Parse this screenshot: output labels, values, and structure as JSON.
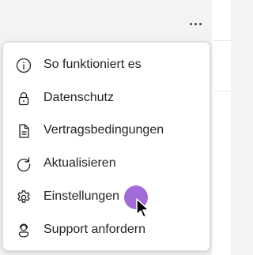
{
  "toolbar": {
    "more_icon": "more-horizontal-icon"
  },
  "menu": {
    "items": [
      {
        "label": "So funktioniert es",
        "icon": "info-icon"
      },
      {
        "label": "Datenschutz",
        "icon": "lock-icon"
      },
      {
        "label": "Vertragsbedingungen",
        "icon": "document-icon"
      },
      {
        "label": "Aktualisieren",
        "icon": "refresh-icon"
      },
      {
        "label": "Einstellungen",
        "icon": "gear-icon"
      },
      {
        "label": "Support anfordern",
        "icon": "person-support-icon"
      }
    ]
  },
  "colors": {
    "text": "#242424",
    "menu_background": "#ffffff",
    "page_background": "#f3f3f3",
    "cursor_highlight": "#9c63d6"
  }
}
